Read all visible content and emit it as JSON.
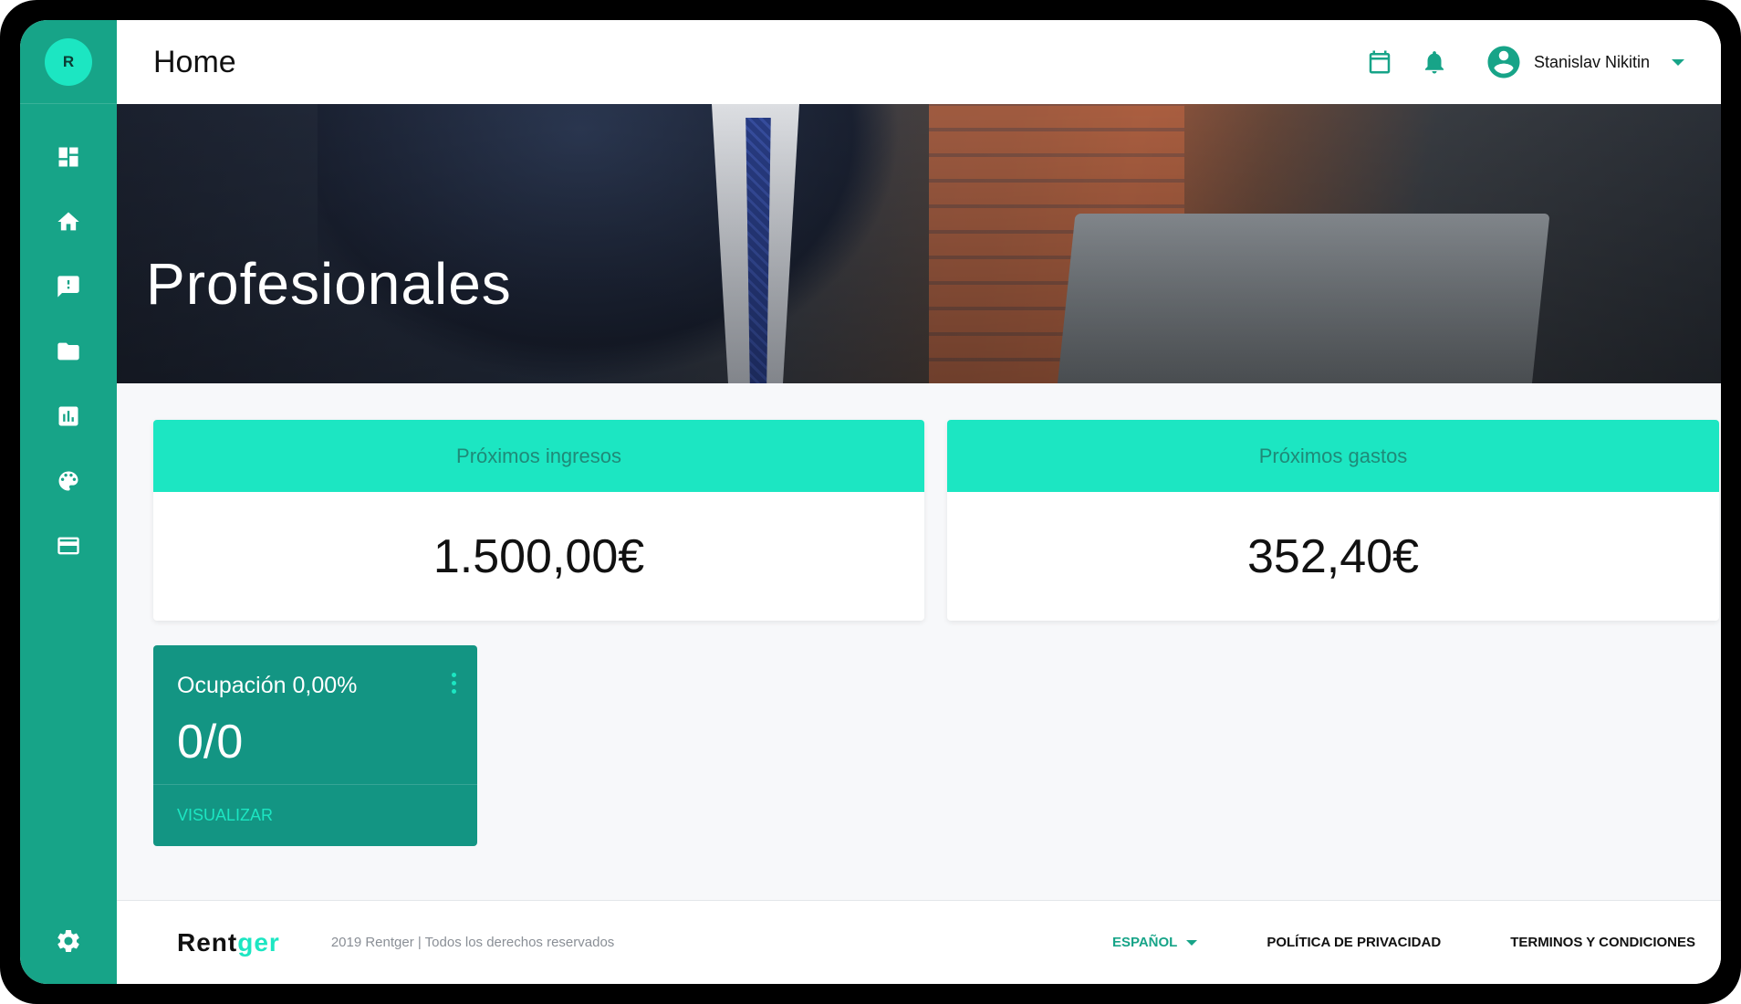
{
  "colors": {
    "primary": "#17a488",
    "accent": "#1ce6c2",
    "dark_card": "#139583",
    "background": "#f7f8fa"
  },
  "sidebar": {
    "avatar_initial": "R",
    "items": [
      {
        "icon": "dashboard-icon"
      },
      {
        "icon": "home-icon"
      },
      {
        "icon": "feedback-icon"
      },
      {
        "icon": "folder-icon"
      },
      {
        "icon": "chart-icon"
      },
      {
        "icon": "palette-icon"
      },
      {
        "icon": "credit-card-icon"
      }
    ],
    "settings_icon": "gear-icon"
  },
  "header": {
    "title": "Home",
    "calendar_icon": "calendar-icon",
    "notifications_icon": "bell-icon",
    "user_name": "Stanislav Nikitin"
  },
  "hero": {
    "title": "Profesionales"
  },
  "cards": {
    "income": {
      "label": "Próximos ingresos",
      "value": "1.500,00€"
    },
    "expenses": {
      "label": "Próximos gastos",
      "value": "352,40€"
    }
  },
  "occupancy": {
    "title": "Ocupación 0,00%",
    "value": "0/0",
    "action": "VISUALIZAR"
  },
  "footer": {
    "logo_part1": "Rent",
    "logo_part2": "ger",
    "copyright": "2019 Rentger | Todos los derechos reservados",
    "language": "ESPAÑOL",
    "privacy": "POLÍTICA DE PRIVACIDAD",
    "terms": "TERMINOS Y CONDICIONES"
  }
}
